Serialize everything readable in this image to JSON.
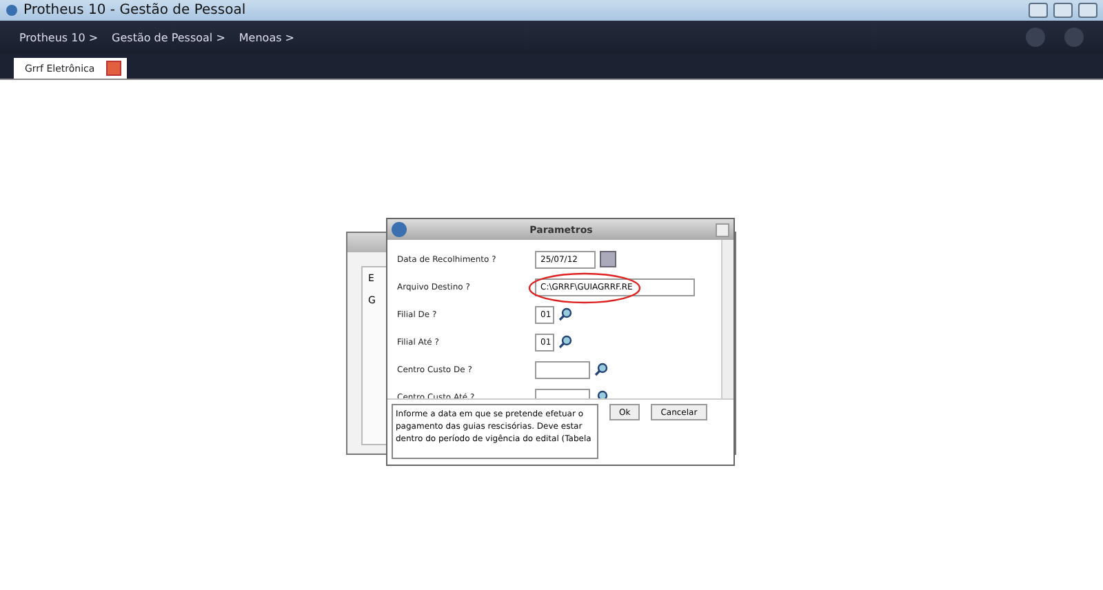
{
  "window": {
    "title": "Protheus 10 - Gestão de Pessoal"
  },
  "breadcrumbs": [
    "Protheus 10 >",
    "Gestão de Pessoal >",
    "Menoas >"
  ],
  "tabs": [
    {
      "label": "Grrf Eletrônica",
      "selected": true
    }
  ],
  "background_dialog": {
    "fragments": [
      "E",
      "G"
    ]
  },
  "dialog": {
    "title": "Parametros",
    "fields": [
      {
        "label": "Data de Recolhimento ?",
        "kind": "date",
        "value": "25/07/12"
      },
      {
        "label": "Arquivo Destino ?",
        "kind": "text",
        "value": "C:\\GRRF\\GUIAGRRF.RE",
        "circled": true
      },
      {
        "label": "Filial De ?",
        "kind": "lookup",
        "value": "01"
      },
      {
        "label": "Filial Até ?",
        "kind": "lookup",
        "value": "01"
      },
      {
        "label": "Centro Custo De  ?",
        "kind": "lookup"
      },
      {
        "label": "Centro Custo Até  ?",
        "kind": "lookup"
      }
    ],
    "help": "Informe a data em que se pretende efetuar o pagamento das guias rescisórias. Deve estar dentro do período de vigência do  edital (Tabela",
    "buttons": [
      "Ok",
      "Cancelar"
    ]
  }
}
